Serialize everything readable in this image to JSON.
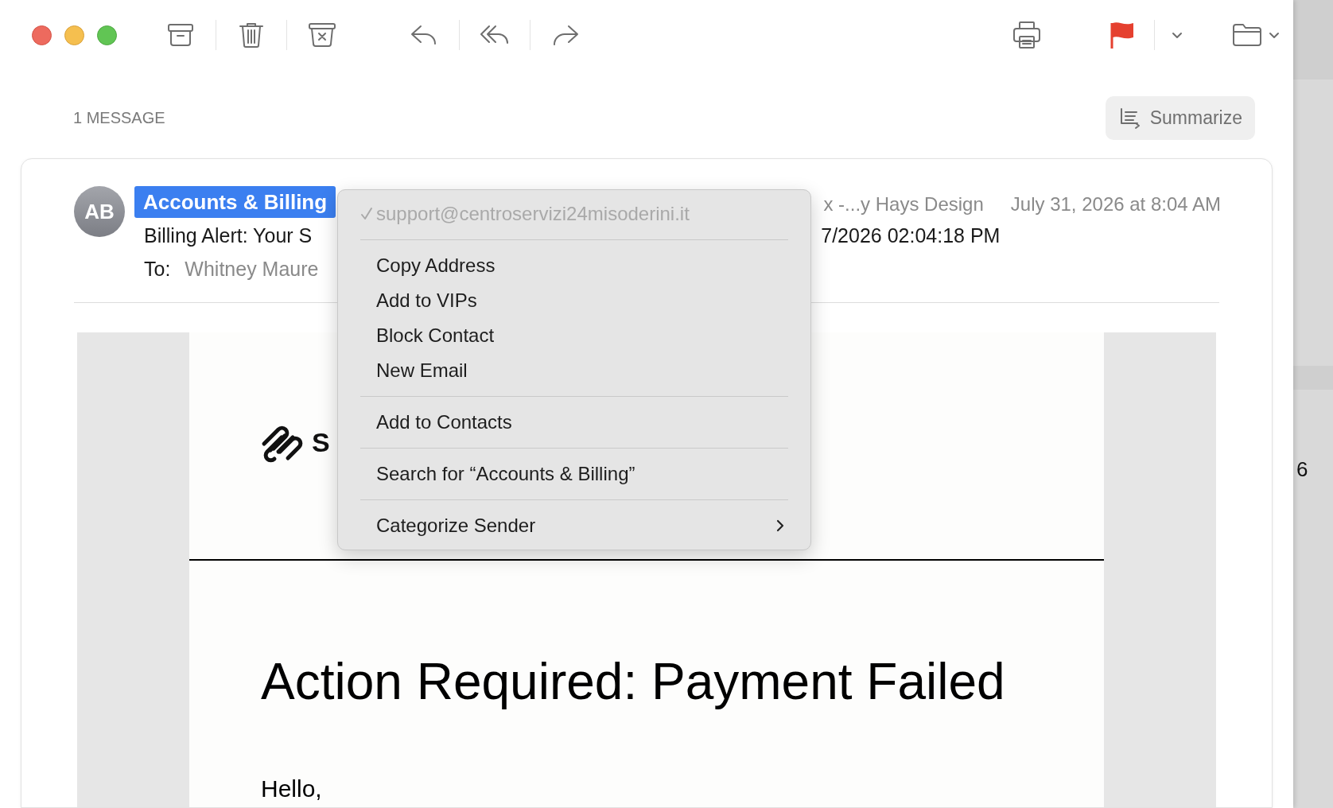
{
  "toolbar": {
    "left": [
      {
        "kind": "archive"
      },
      {
        "kind": "trash"
      },
      {
        "kind": "junk"
      },
      {
        "kind": "reply"
      },
      {
        "kind": "reply-all"
      },
      {
        "kind": "forward"
      }
    ],
    "right": [
      {
        "kind": "print"
      },
      {
        "kind": "flag",
        "color": "#e5402f"
      },
      {
        "kind": "folder"
      }
    ]
  },
  "message_count": "1 MESSAGE",
  "summarize": {
    "label": "Summarize"
  },
  "message": {
    "avatar": "AB",
    "sender": {
      "name": "Accounts & Billing",
      "selected": true
    },
    "recipient_fragment": "x -...y Hays Design",
    "date": "July 31, 2026 at 8:04 AM",
    "subject_left": "Billing Alert: Your S",
    "subject_right": "7/2026 02:04:18 PM",
    "to_label": "To:",
    "to_value": "Whitney Maure"
  },
  "body": {
    "logo_text": "S",
    "heading": "Action Required: Payment Failed",
    "greeting": "Hello,"
  },
  "context_menu": [
    {
      "kind": "item",
      "label": "support@centroservizi24misoderini.it",
      "checked": true,
      "disabled": true
    },
    {
      "kind": "separator"
    },
    {
      "kind": "item",
      "label": "Copy Address",
      "checked": false,
      "disabled": false
    },
    {
      "kind": "item",
      "label": "Add to VIPs",
      "checked": false,
      "disabled": false
    },
    {
      "kind": "item",
      "label": "Block Contact",
      "checked": false,
      "disabled": false
    },
    {
      "kind": "item",
      "label": "New Email",
      "checked": false,
      "disabled": false
    },
    {
      "kind": "separator"
    },
    {
      "kind": "item",
      "label": "Add to Contacts",
      "checked": false,
      "disabled": false
    },
    {
      "kind": "separator"
    },
    {
      "kind": "item",
      "label": "Search for “Accounts & Billing”",
      "checked": false,
      "disabled": false
    },
    {
      "kind": "separator"
    },
    {
      "kind": "submenu",
      "label": "Categorize Sender",
      "checked": false,
      "disabled": false
    }
  ],
  "background_window": {
    "fragment": "6"
  }
}
